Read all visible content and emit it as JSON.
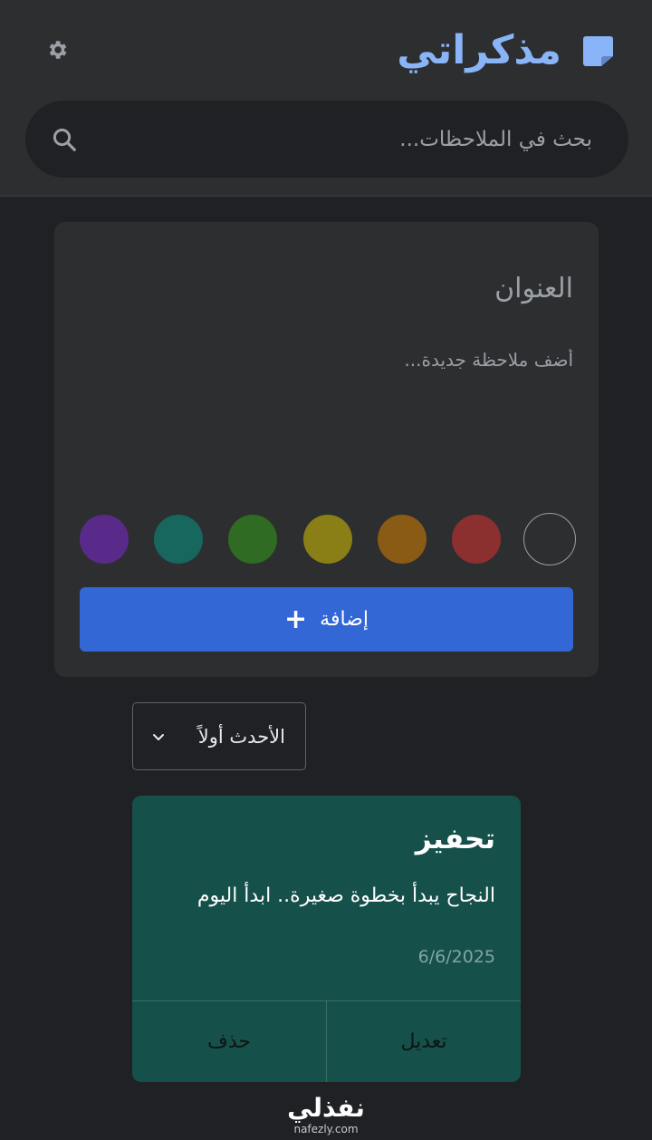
{
  "header": {
    "app_title": "مذكراتي",
    "brand_icon": "sticky-note-icon",
    "settings_icon": "gear-icon"
  },
  "search": {
    "placeholder": "بحث في الملاحظات...",
    "icon": "search-icon"
  },
  "composer": {
    "title_placeholder": "العنوان",
    "body_placeholder": "أضف ملاحظة جديدة...",
    "colors": [
      "none",
      "#8b2f2f",
      "#8a5b14",
      "#8a7f16",
      "#2f6b22",
      "#17675e",
      "#5a2a8a"
    ],
    "add_label": "إضافة",
    "add_icon": "plus-icon"
  },
  "sort": {
    "selected": "الأحدث أولاً",
    "icon": "chevron-down-icon"
  },
  "notes": [
    {
      "title": "تحفيز",
      "text": "النجاح يبدأ بخطوة صغيرة.. ابدأ اليوم",
      "date": "6/6/2025",
      "color": "#16504a",
      "edit_label": "تعديل",
      "delete_label": "حذف"
    }
  ],
  "watermark": {
    "logo": "نفذلي",
    "url": "nafezly.com"
  },
  "theme": {
    "accent": "#8ab4f8",
    "button": "#3367d6",
    "background": "#202124",
    "surface": "#2d2e30"
  }
}
